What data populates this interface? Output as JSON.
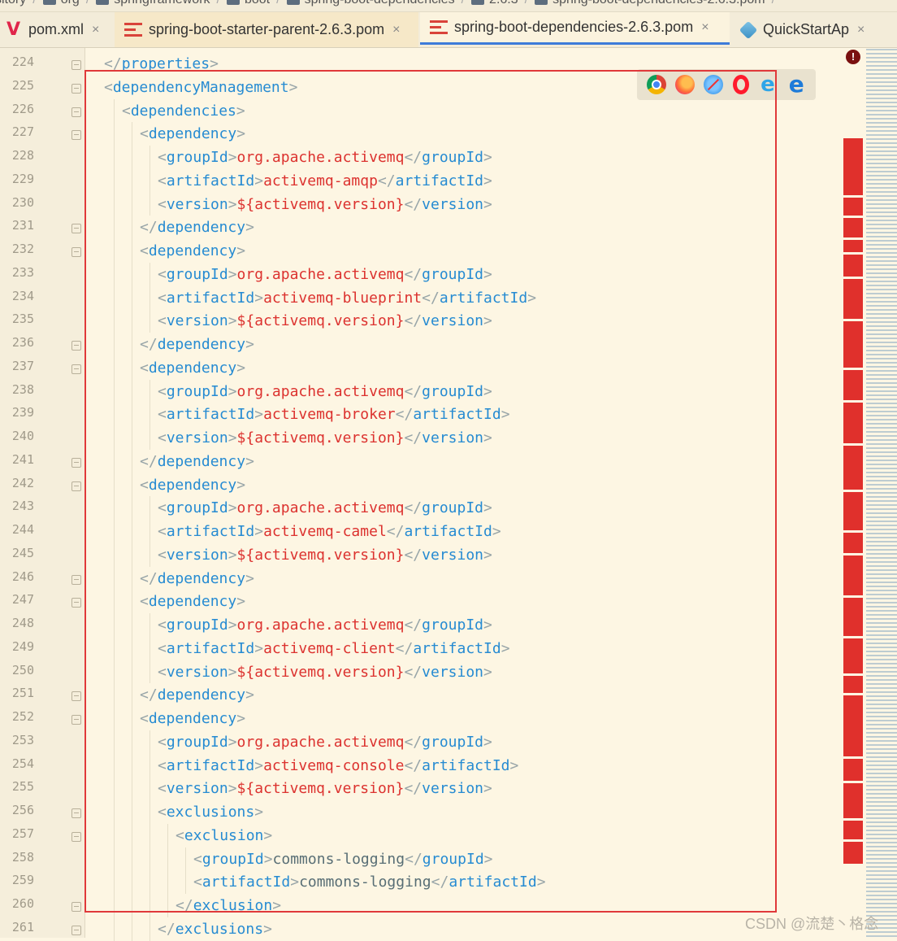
{
  "breadcrumb": {
    "items": [
      "sitory",
      "org",
      "springframework",
      "boot",
      "spring-boot-dependencies",
      "2.6.3",
      "spring-boot-dependencies-2.6.3.pom"
    ]
  },
  "tabs": [
    {
      "label": "pom.xml",
      "icon": "vim-v-icon"
    },
    {
      "label": "spring-boot-starter-parent-2.6.3.pom",
      "icon": "maven-pom-icon"
    },
    {
      "label": "spring-boot-dependencies-2.6.3.pom",
      "icon": "maven-pom-icon",
      "active": true
    },
    {
      "label": "QuickStartAp",
      "icon": "java-class-icon"
    }
  ],
  "tab_close_glyph": "×",
  "error_marker": "!",
  "line_numbers": [
    "224",
    "225",
    "226",
    "227",
    "228",
    "229",
    "230",
    "231",
    "232",
    "233",
    "234",
    "235",
    "236",
    "237",
    "238",
    "239",
    "240",
    "241",
    "242",
    "243",
    "244",
    "245",
    "246",
    "247",
    "248",
    "249",
    "250",
    "251",
    "252",
    "253",
    "254",
    "255",
    "256",
    "257",
    "258",
    "259",
    "260",
    "261"
  ],
  "code_lines": [
    {
      "indent": 0,
      "tokens": [
        [
          "b",
          "</"
        ],
        [
          "t",
          "properties"
        ],
        [
          "b",
          ">"
        ]
      ]
    },
    {
      "indent": 0,
      "tokens": [
        [
          "b",
          "<"
        ],
        [
          "t",
          "dependencyManagement"
        ],
        [
          "b",
          ">"
        ]
      ]
    },
    {
      "indent": 1,
      "tokens": [
        [
          "b",
          "<"
        ],
        [
          "t",
          "dependencies"
        ],
        [
          "b",
          ">"
        ]
      ]
    },
    {
      "indent": 2,
      "tokens": [
        [
          "b",
          "<"
        ],
        [
          "t",
          "dependency"
        ],
        [
          "b",
          ">"
        ]
      ]
    },
    {
      "indent": 3,
      "tokens": [
        [
          "b",
          "<"
        ],
        [
          "t",
          "groupId"
        ],
        [
          "b",
          ">"
        ],
        [
          "v",
          "org.apache.activemq"
        ],
        [
          "b",
          "</"
        ],
        [
          "t",
          "groupId"
        ],
        [
          "b",
          ">"
        ]
      ]
    },
    {
      "indent": 3,
      "tokens": [
        [
          "b",
          "<"
        ],
        [
          "t",
          "artifactId"
        ],
        [
          "b",
          ">"
        ],
        [
          "v",
          "activemq-amqp"
        ],
        [
          "b",
          "</"
        ],
        [
          "t",
          "artifactId"
        ],
        [
          "b",
          ">"
        ]
      ]
    },
    {
      "indent": 3,
      "tokens": [
        [
          "b",
          "<"
        ],
        [
          "t",
          "version"
        ],
        [
          "b",
          ">"
        ],
        [
          "v",
          "${activemq.version}"
        ],
        [
          "b",
          "</"
        ],
        [
          "t",
          "version"
        ],
        [
          "b",
          ">"
        ]
      ]
    },
    {
      "indent": 2,
      "tokens": [
        [
          "b",
          "</"
        ],
        [
          "t",
          "dependency"
        ],
        [
          "b",
          ">"
        ]
      ]
    },
    {
      "indent": 2,
      "tokens": [
        [
          "b",
          "<"
        ],
        [
          "t",
          "dependency"
        ],
        [
          "b",
          ">"
        ]
      ]
    },
    {
      "indent": 3,
      "tokens": [
        [
          "b",
          "<"
        ],
        [
          "t",
          "groupId"
        ],
        [
          "b",
          ">"
        ],
        [
          "v",
          "org.apache.activemq"
        ],
        [
          "b",
          "</"
        ],
        [
          "t",
          "groupId"
        ],
        [
          "b",
          ">"
        ]
      ]
    },
    {
      "indent": 3,
      "tokens": [
        [
          "b",
          "<"
        ],
        [
          "t",
          "artifactId"
        ],
        [
          "b",
          ">"
        ],
        [
          "v",
          "activemq-blueprint"
        ],
        [
          "b",
          "</"
        ],
        [
          "t",
          "artifactId"
        ],
        [
          "b",
          ">"
        ]
      ]
    },
    {
      "indent": 3,
      "tokens": [
        [
          "b",
          "<"
        ],
        [
          "t",
          "version"
        ],
        [
          "b",
          ">"
        ],
        [
          "v",
          "${activemq.version}"
        ],
        [
          "b",
          "</"
        ],
        [
          "t",
          "version"
        ],
        [
          "b",
          ">"
        ]
      ]
    },
    {
      "indent": 2,
      "tokens": [
        [
          "b",
          "</"
        ],
        [
          "t",
          "dependency"
        ],
        [
          "b",
          ">"
        ]
      ]
    },
    {
      "indent": 2,
      "tokens": [
        [
          "b",
          "<"
        ],
        [
          "t",
          "dependency"
        ],
        [
          "b",
          ">"
        ]
      ]
    },
    {
      "indent": 3,
      "tokens": [
        [
          "b",
          "<"
        ],
        [
          "t",
          "groupId"
        ],
        [
          "b",
          ">"
        ],
        [
          "v",
          "org.apache.activemq"
        ],
        [
          "b",
          "</"
        ],
        [
          "t",
          "groupId"
        ],
        [
          "b",
          ">"
        ]
      ]
    },
    {
      "indent": 3,
      "tokens": [
        [
          "b",
          "<"
        ],
        [
          "t",
          "artifactId"
        ],
        [
          "b",
          ">"
        ],
        [
          "v",
          "activemq-broker"
        ],
        [
          "b",
          "</"
        ],
        [
          "t",
          "artifactId"
        ],
        [
          "b",
          ">"
        ]
      ]
    },
    {
      "indent": 3,
      "tokens": [
        [
          "b",
          "<"
        ],
        [
          "t",
          "version"
        ],
        [
          "b",
          ">"
        ],
        [
          "v",
          "${activemq.version}"
        ],
        [
          "b",
          "</"
        ],
        [
          "t",
          "version"
        ],
        [
          "b",
          ">"
        ]
      ]
    },
    {
      "indent": 2,
      "tokens": [
        [
          "b",
          "</"
        ],
        [
          "t",
          "dependency"
        ],
        [
          "b",
          ">"
        ]
      ]
    },
    {
      "indent": 2,
      "tokens": [
        [
          "b",
          "<"
        ],
        [
          "t",
          "dependency"
        ],
        [
          "b",
          ">"
        ]
      ]
    },
    {
      "indent": 3,
      "tokens": [
        [
          "b",
          "<"
        ],
        [
          "t",
          "groupId"
        ],
        [
          "b",
          ">"
        ],
        [
          "v",
          "org.apache.activemq"
        ],
        [
          "b",
          "</"
        ],
        [
          "t",
          "groupId"
        ],
        [
          "b",
          ">"
        ]
      ]
    },
    {
      "indent": 3,
      "tokens": [
        [
          "b",
          "<"
        ],
        [
          "t",
          "artifactId"
        ],
        [
          "b",
          ">"
        ],
        [
          "v",
          "activemq-camel"
        ],
        [
          "b",
          "</"
        ],
        [
          "t",
          "artifactId"
        ],
        [
          "b",
          ">"
        ]
      ]
    },
    {
      "indent": 3,
      "tokens": [
        [
          "b",
          "<"
        ],
        [
          "t",
          "version"
        ],
        [
          "b",
          ">"
        ],
        [
          "v",
          "${activemq.version}"
        ],
        [
          "b",
          "</"
        ],
        [
          "t",
          "version"
        ],
        [
          "b",
          ">"
        ]
      ]
    },
    {
      "indent": 2,
      "tokens": [
        [
          "b",
          "</"
        ],
        [
          "t",
          "dependency"
        ],
        [
          "b",
          ">"
        ]
      ]
    },
    {
      "indent": 2,
      "tokens": [
        [
          "b",
          "<"
        ],
        [
          "t",
          "dependency"
        ],
        [
          "b",
          ">"
        ]
      ]
    },
    {
      "indent": 3,
      "tokens": [
        [
          "b",
          "<"
        ],
        [
          "t",
          "groupId"
        ],
        [
          "b",
          ">"
        ],
        [
          "v",
          "org.apache.activemq"
        ],
        [
          "b",
          "</"
        ],
        [
          "t",
          "groupId"
        ],
        [
          "b",
          ">"
        ]
      ]
    },
    {
      "indent": 3,
      "tokens": [
        [
          "b",
          "<"
        ],
        [
          "t",
          "artifactId"
        ],
        [
          "b",
          ">"
        ],
        [
          "v",
          "activemq-client"
        ],
        [
          "b",
          "</"
        ],
        [
          "t",
          "artifactId"
        ],
        [
          "b",
          ">"
        ]
      ]
    },
    {
      "indent": 3,
      "tokens": [
        [
          "b",
          "<"
        ],
        [
          "t",
          "version"
        ],
        [
          "b",
          ">"
        ],
        [
          "v",
          "${activemq.version}"
        ],
        [
          "b",
          "</"
        ],
        [
          "t",
          "version"
        ],
        [
          "b",
          ">"
        ]
      ]
    },
    {
      "indent": 2,
      "tokens": [
        [
          "b",
          "</"
        ],
        [
          "t",
          "dependency"
        ],
        [
          "b",
          ">"
        ]
      ]
    },
    {
      "indent": 2,
      "tokens": [
        [
          "b",
          "<"
        ],
        [
          "t",
          "dependency"
        ],
        [
          "b",
          ">"
        ]
      ]
    },
    {
      "indent": 3,
      "tokens": [
        [
          "b",
          "<"
        ],
        [
          "t",
          "groupId"
        ],
        [
          "b",
          ">"
        ],
        [
          "v",
          "org.apache.activemq"
        ],
        [
          "b",
          "</"
        ],
        [
          "t",
          "groupId"
        ],
        [
          "b",
          ">"
        ]
      ]
    },
    {
      "indent": 3,
      "tokens": [
        [
          "b",
          "<"
        ],
        [
          "t",
          "artifactId"
        ],
        [
          "b",
          ">"
        ],
        [
          "v",
          "activemq-console"
        ],
        [
          "b",
          "</"
        ],
        [
          "t",
          "artifactId"
        ],
        [
          "b",
          ">"
        ]
      ]
    },
    {
      "indent": 3,
      "tokens": [
        [
          "b",
          "<"
        ],
        [
          "t",
          "version"
        ],
        [
          "b",
          ">"
        ],
        [
          "v",
          "${activemq.version}"
        ],
        [
          "b",
          "</"
        ],
        [
          "t",
          "version"
        ],
        [
          "b",
          ">"
        ]
      ]
    },
    {
      "indent": 3,
      "tokens": [
        [
          "b",
          "<"
        ],
        [
          "t",
          "exclusions"
        ],
        [
          "b",
          ">"
        ]
      ]
    },
    {
      "indent": 4,
      "tokens": [
        [
          "b",
          "<"
        ],
        [
          "t",
          "exclusion"
        ],
        [
          "b",
          ">"
        ]
      ]
    },
    {
      "indent": 5,
      "tokens": [
        [
          "b",
          "<"
        ],
        [
          "t",
          "groupId"
        ],
        [
          "b",
          ">"
        ],
        [
          "p",
          "commons-logging"
        ],
        [
          "b",
          "</"
        ],
        [
          "t",
          "groupId"
        ],
        [
          "b",
          ">"
        ]
      ]
    },
    {
      "indent": 5,
      "tokens": [
        [
          "b",
          "<"
        ],
        [
          "t",
          "artifactId"
        ],
        [
          "b",
          ">"
        ],
        [
          "p",
          "commons-logging"
        ],
        [
          "b",
          "</"
        ],
        [
          "t",
          "artifactId"
        ],
        [
          "b",
          ">"
        ]
      ]
    },
    {
      "indent": 4,
      "tokens": [
        [
          "b",
          "</"
        ],
        [
          "t",
          "exclusion"
        ],
        [
          "b",
          ">"
        ]
      ]
    },
    {
      "indent": 3,
      "tokens": [
        [
          "b",
          "</"
        ],
        [
          "t",
          "exclusions"
        ],
        [
          "b",
          ">"
        ]
      ]
    }
  ],
  "browser_icons": [
    "chrome-icon",
    "firefox-icon",
    "safari-icon",
    "opera-icon",
    "ie-icon",
    "edge-icon"
  ],
  "watermark": "CSDN @流楚丶格念",
  "colors": {
    "background": "#fdf6e3",
    "tag": "#268bd2",
    "value": "#dc322f",
    "highlight_box": "#e0393a",
    "active_tab_underline": "#3d7bd9"
  }
}
